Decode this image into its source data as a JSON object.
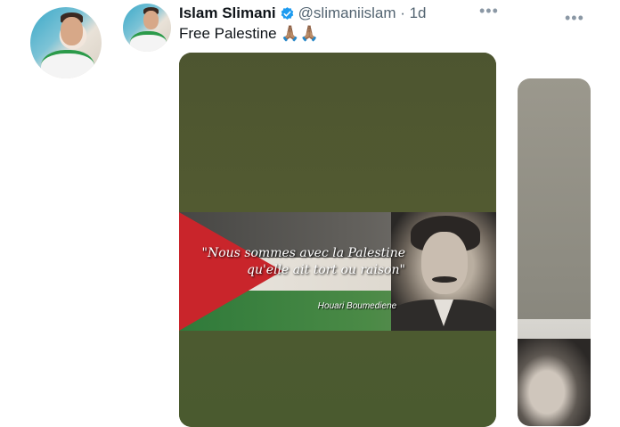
{
  "tweet": {
    "author_name": "Islam Slimani",
    "handle_time": "@slimaniislam · 1d",
    "text": "Free Palestine 🙏🏽🙏🏽",
    "verified": true,
    "accent_color": "#1d9bf0"
  },
  "media": {
    "quote": "\"Nous sommes avec la Palestine qu'elle ait tort ou raison\"",
    "author": "Houari Boumediene"
  },
  "menu": {
    "more_glyph": "•••"
  }
}
